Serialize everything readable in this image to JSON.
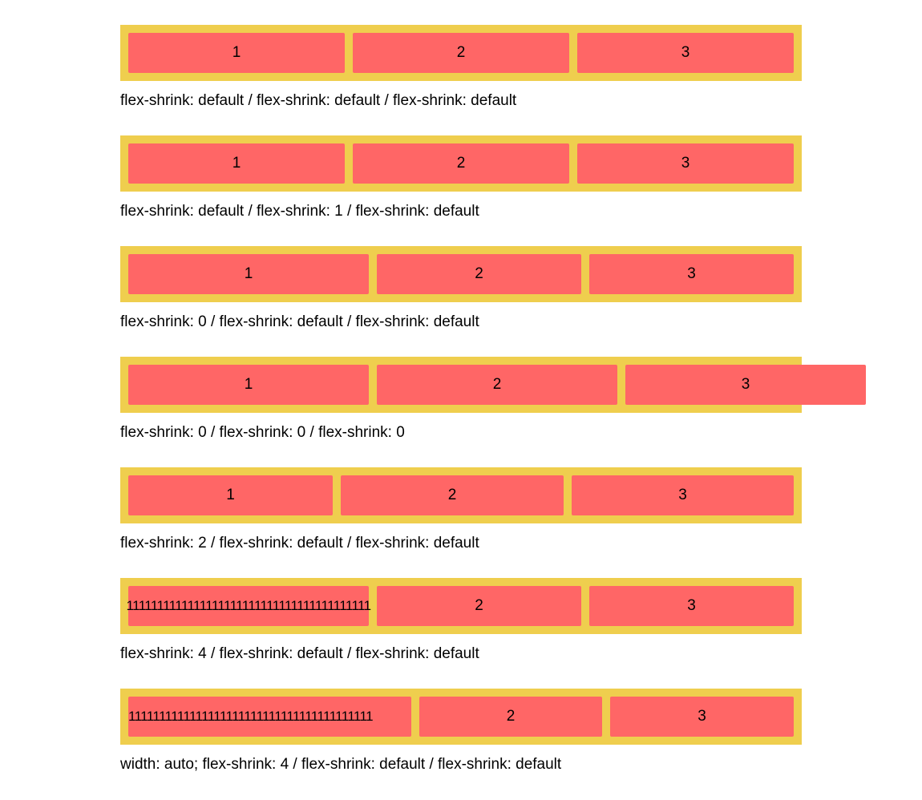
{
  "colors": {
    "container": "#EFCE4E",
    "item": "#FF6666",
    "text": "#000000",
    "background": "#FFFFFF"
  },
  "demos": [
    {
      "items": [
        "1",
        "2",
        "3"
      ],
      "caption": "flex-shrink: default / flex-shrink: default / flex-shrink: default"
    },
    {
      "items": [
        "1",
        "2",
        "3"
      ],
      "caption": "flex-shrink: default / flex-shrink: 1 / flex-shrink: default"
    },
    {
      "items": [
        "1",
        "2",
        "3"
      ],
      "caption": "flex-shrink: 0 / flex-shrink: default / flex-shrink: default"
    },
    {
      "items": [
        "1",
        "2",
        "3"
      ],
      "caption": "flex-shrink: 0 / flex-shrink: 0 / flex-shrink: 0"
    },
    {
      "items": [
        "1",
        "2",
        "3"
      ],
      "caption": "flex-shrink: 2 / flex-shrink: default / flex-shrink: default"
    },
    {
      "items": [
        "1111111111111111111111111111111111111111",
        "2",
        "3"
      ],
      "caption": "flex-shrink: 4 / flex-shrink: default / flex-shrink: default"
    },
    {
      "items": [
        "1111111111111111111111111111111111111111",
        "2",
        "3"
      ],
      "caption": "width: auto; flex-shrink: 4 / flex-shrink: default / flex-shrink: default"
    }
  ]
}
